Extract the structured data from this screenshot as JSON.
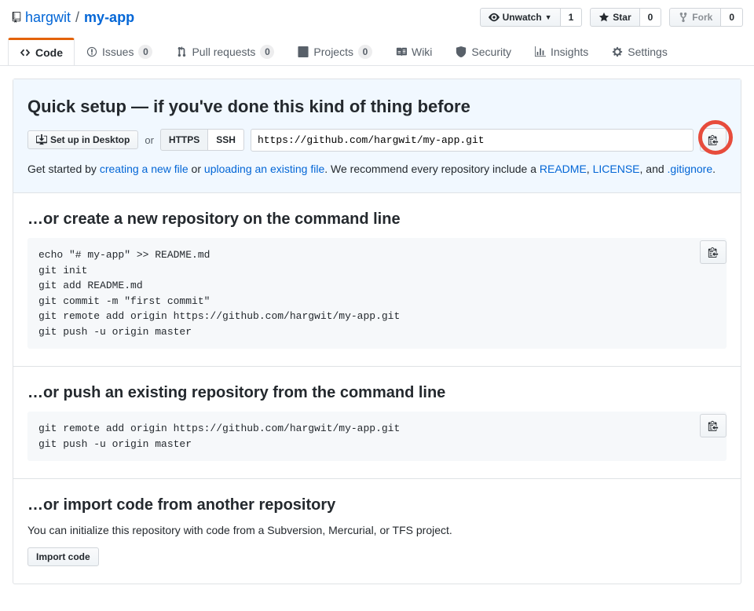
{
  "repo": {
    "owner": "hargwit",
    "name": "my-app"
  },
  "actions": {
    "unwatch": {
      "label": "Unwatch",
      "count": "1"
    },
    "star": {
      "label": "Star",
      "count": "0"
    },
    "fork": {
      "label": "Fork",
      "count": "0"
    }
  },
  "nav": {
    "code": "Code",
    "issues": {
      "label": "Issues",
      "count": "0"
    },
    "pulls": {
      "label": "Pull requests",
      "count": "0"
    },
    "projects": {
      "label": "Projects",
      "count": "0"
    },
    "wiki": "Wiki",
    "security": "Security",
    "insights": "Insights",
    "settings": "Settings"
  },
  "quick": {
    "title": "Quick setup — if you've done this kind of thing before",
    "setup_desktop": "Set up in Desktop",
    "or": "or",
    "https": "HTTPS",
    "ssh": "SSH",
    "clone_url": "https://github.com/hargwit/my-app.git",
    "help_pre": "Get started by ",
    "help_newfile": "creating a new file",
    "help_or": " or ",
    "help_upload": "uploading an existing file",
    "help_rec": ". We recommend every repository include a ",
    "help_readme": "README",
    "help_comma1": ", ",
    "help_license": "LICENSE",
    "help_comma2": ", and ",
    "help_gitignore": ".gitignore",
    "help_period": "."
  },
  "create_section": {
    "title": "…or create a new repository on the command line",
    "code": "echo \"# my-app\" >> README.md\ngit init\ngit add README.md\ngit commit -m \"first commit\"\ngit remote add origin https://github.com/hargwit/my-app.git\ngit push -u origin master"
  },
  "push_section": {
    "title": "…or push an existing repository from the command line",
    "code": "git remote add origin https://github.com/hargwit/my-app.git\ngit push -u origin master"
  },
  "import_section": {
    "title": "…or import code from another repository",
    "desc": "You can initialize this repository with code from a Subversion, Mercurial, or TFS project.",
    "button": "Import code"
  }
}
